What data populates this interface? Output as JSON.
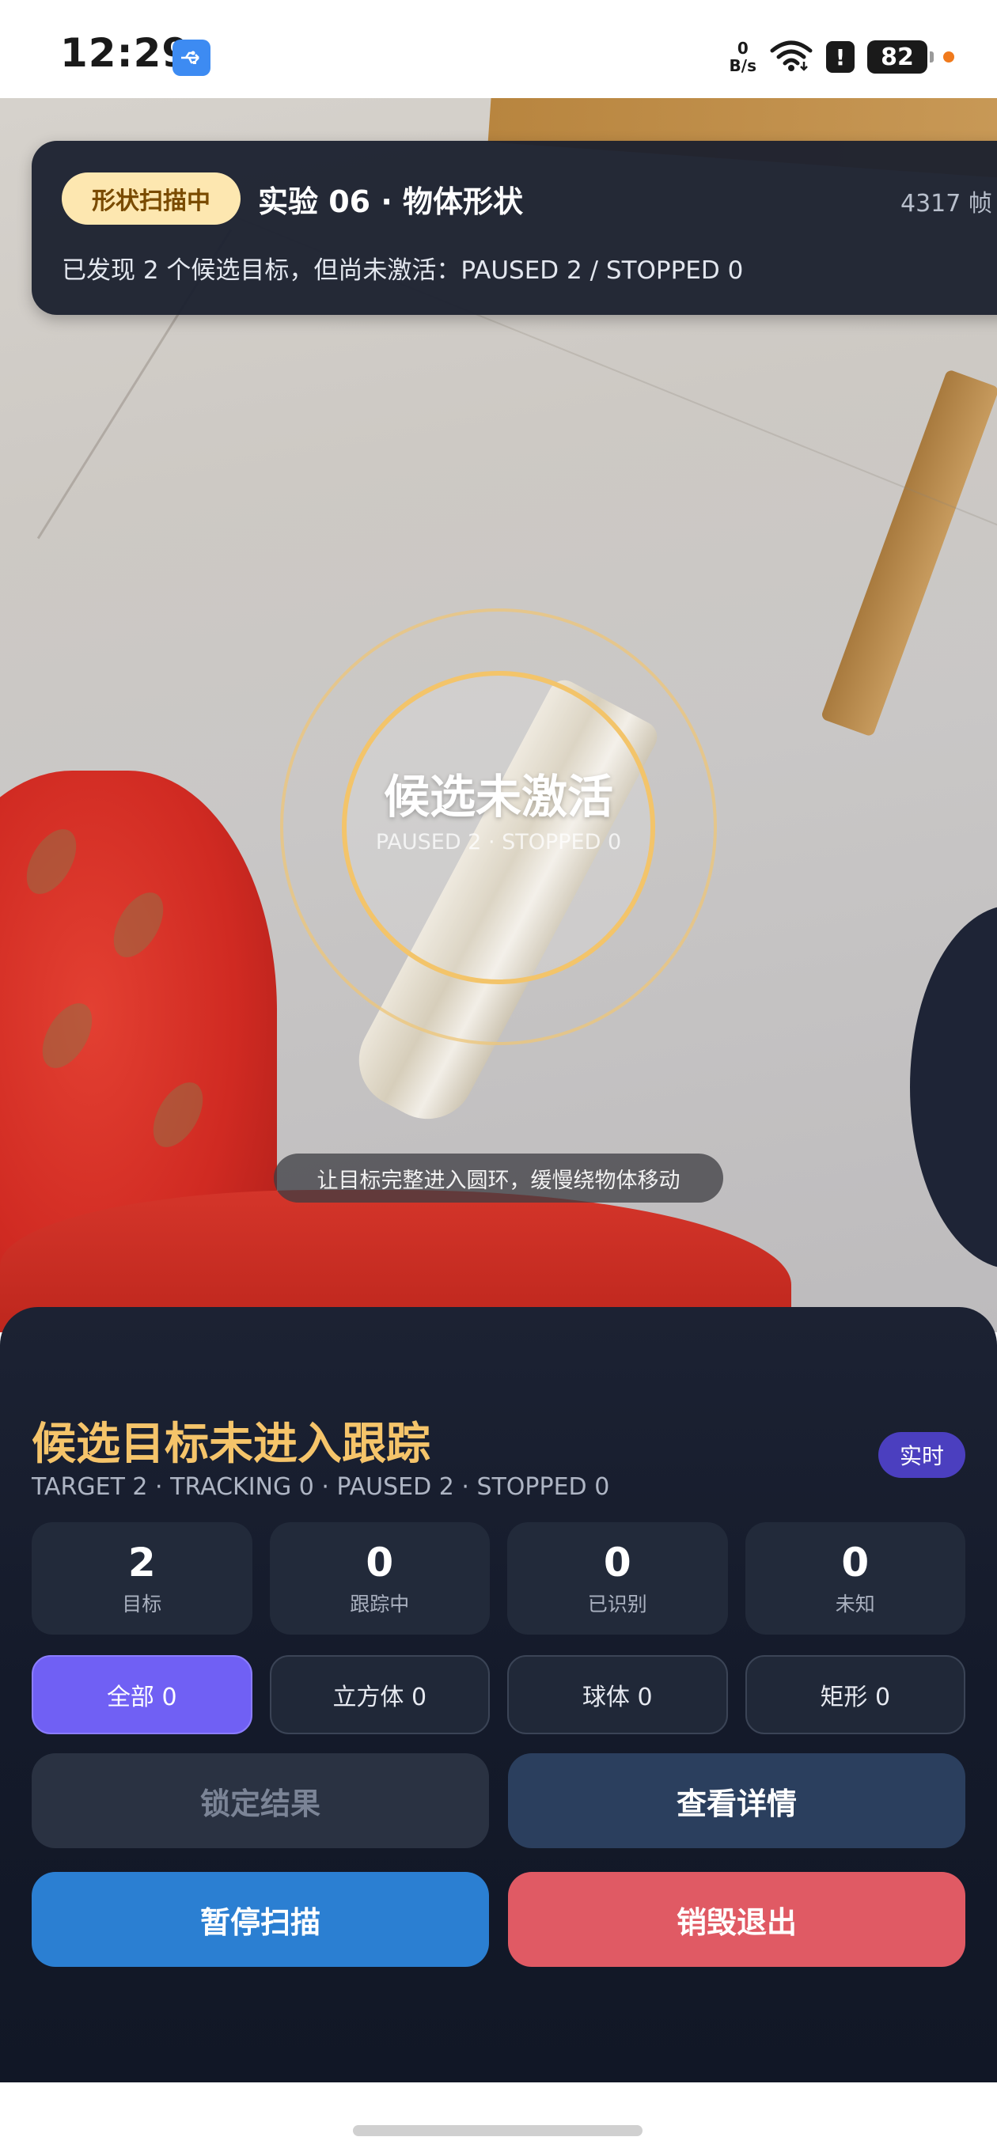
{
  "status_bar": {
    "time": "12:29",
    "net_speed_value": "0",
    "net_speed_unit": "B/s",
    "battery": "82",
    "icons": [
      "usb-icon",
      "wifi-icon",
      "alert-icon",
      "battery-icon"
    ]
  },
  "header_card": {
    "badge": "形状扫描中",
    "title": "实验 06 · 物体形状",
    "frame_count": "4317 帧",
    "description": "已发现 2 个候选目标，但尚未激活：PAUSED 2 / STOPPED 0"
  },
  "ring": {
    "title": "候选未激活",
    "subtitle": "PAUSED 2 · STOPPED 0"
  },
  "hint": "让目标完整进入圆环，缓慢绕物体移动",
  "panel": {
    "title": "候选目标未进入跟踪",
    "realtime_label": "实时",
    "subtitle": "TARGET 2 · TRACKING 0 · PAUSED 2 · STOPPED 0",
    "stats": [
      {
        "value": "2",
        "label": "目标"
      },
      {
        "value": "0",
        "label": "跟踪中"
      },
      {
        "value": "0",
        "label": "已识别"
      },
      {
        "value": "0",
        "label": "未知"
      }
    ],
    "filters": [
      {
        "label": "全部 0",
        "active": true
      },
      {
        "label": "立方体 0",
        "active": false
      },
      {
        "label": "球体 0",
        "active": false
      },
      {
        "label": "矩形 0",
        "active": false
      }
    ],
    "buttons": {
      "lock": "锁定结果",
      "detail": "查看详情",
      "pause": "暂停扫描",
      "destroy": "销毁退出"
    }
  },
  "colors": {
    "accent_gold": "#f5c46a",
    "accent_purple": "#7060f4",
    "pause_blue": "#2b7fd2",
    "destroy_red": "#e05a64"
  }
}
